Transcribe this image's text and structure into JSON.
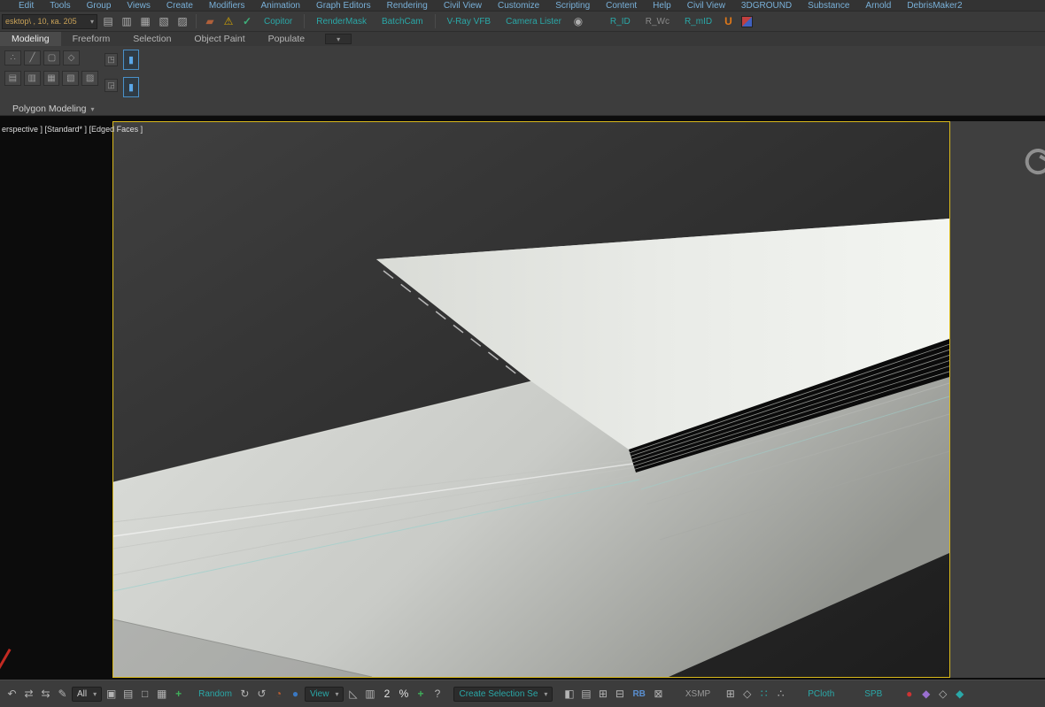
{
  "colors": {
    "menu_text": "#79b0d8",
    "teal_accent": "#2aa8a8",
    "viewport_border": "#d9b91c"
  },
  "menubar": {
    "items": [
      {
        "label": "Edit"
      },
      {
        "label": "Tools"
      },
      {
        "label": "Group"
      },
      {
        "label": "Views"
      },
      {
        "label": "Create"
      },
      {
        "label": "Modifiers"
      },
      {
        "label": "Animation"
      },
      {
        "label": "Graph Editors"
      },
      {
        "label": "Rendering"
      },
      {
        "label": "Civil View"
      },
      {
        "label": "Customize"
      },
      {
        "label": "Scripting"
      },
      {
        "label": "Content"
      },
      {
        "label": "Help"
      },
      {
        "label": "Civil View"
      },
      {
        "label": "3DGROUND"
      },
      {
        "label": "Substance"
      },
      {
        "label": "Arnold"
      },
      {
        "label": "DebrisMaker2"
      }
    ]
  },
  "toolbar": {
    "selection_set_value": "esktop\\ , 10, ка. 205",
    "caret": "▾",
    "icons": {
      "set1": "▤",
      "set2": "▥",
      "set3": "▦",
      "set4": "▧",
      "set5": "▨",
      "paint": "▰",
      "warning": "⚠",
      "check": "✓",
      "camera": "◉"
    },
    "buttons": {
      "copitor": "Copitor",
      "rendermask": "RenderMask",
      "batchcam": "BatchCam",
      "vray_vfb": "V-Ray VFB",
      "camera_lister": "Camera Lister",
      "r_id": "R_ID",
      "r_wc": "R_Wc",
      "r_mid": "R_mID",
      "u_tool": "U"
    }
  },
  "ribbon": {
    "tabs": [
      {
        "label": "Modeling",
        "active": true
      },
      {
        "label": "Freeform"
      },
      {
        "label": "Selection"
      },
      {
        "label": "Object Paint"
      },
      {
        "label": "Populate"
      }
    ],
    "tab_extra_caret": "▾",
    "panel_title": "Polygon Modeling",
    "panel_caret": "▾",
    "tools_row1": [
      "∴",
      "╱",
      "▢",
      "◇"
    ],
    "tools_row2": [
      "▤",
      "▥",
      "▦",
      "▧",
      "▨"
    ],
    "minis": [
      "◳",
      "◲"
    ],
    "blue_buttons": [
      "▮",
      "▮"
    ]
  },
  "viewport": {
    "label": "erspective ] [Standard* ] [Edged Faces ]"
  },
  "statusbar": {
    "all_combo": "All",
    "random_label": "Random",
    "view_combo": "View",
    "create_selection_combo": "Create Selection Se",
    "rb_label": "RB",
    "xsmp_label": "XSMP",
    "pcloth_label": "PCloth",
    "spb_label": "SPB",
    "caret": "▾",
    "icons": {
      "undo": "↶",
      "link": "⇄",
      "unlink": "⇆",
      "edit": "✎",
      "filter1": "▣",
      "filter2": "▤",
      "filter3": "□",
      "filter4": "▦",
      "add": "+",
      "refresh1": "↻",
      "refresh2": "↺",
      "sphere": "◔",
      "orb": "●",
      "angle": "◺",
      "grid": "▥",
      "two": "2",
      "percent": "%",
      "plus2": "+",
      "help": "?",
      "panel1": "◧",
      "panel2": "▤",
      "panel3": "⊞",
      "panel4": "⊟",
      "close": "⊠",
      "g1": "⊞",
      "g2": "◇",
      "g3": "∷",
      "g4": "∴",
      "dot": "●",
      "purple": "◆",
      "diamond": "◇",
      "teal_diamond": "◆"
    }
  }
}
